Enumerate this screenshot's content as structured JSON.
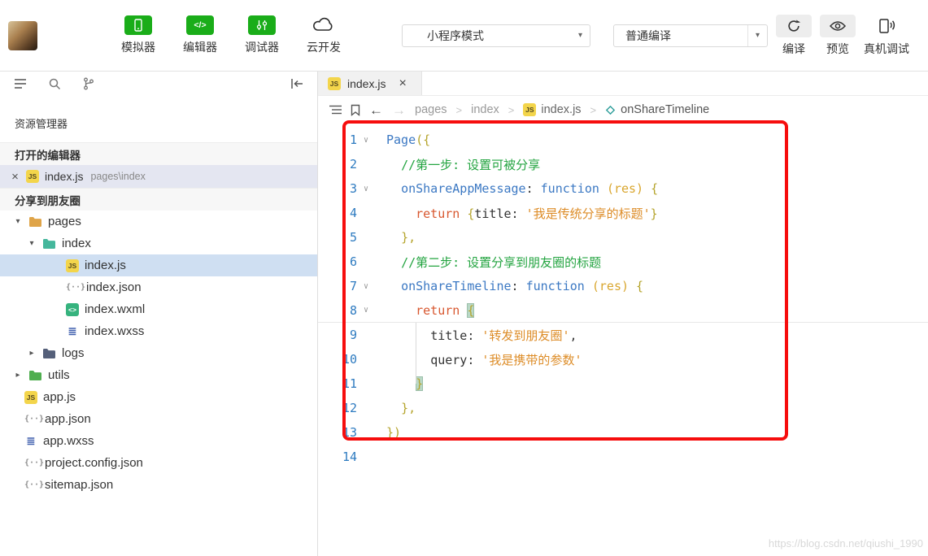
{
  "toolbar": {
    "nav_buttons": [
      {
        "label": "模拟器",
        "icon": "simulator-icon"
      },
      {
        "label": "编辑器",
        "icon": "editor-icon"
      },
      {
        "label": "调试器",
        "icon": "debugger-icon"
      },
      {
        "label": "云开发",
        "icon": "cloud-icon"
      }
    ],
    "mode_dropdown": {
      "value": "小程序模式"
    },
    "compile_dropdown": {
      "value": "普通编译"
    },
    "actions": [
      {
        "label": "编译",
        "icon": "compile-icon"
      },
      {
        "label": "预览",
        "icon": "preview-icon"
      },
      {
        "label": "真机调试",
        "icon": "phone-debug-icon"
      }
    ]
  },
  "sidebar": {
    "explorer_title": "资源管理器",
    "open_editors": {
      "header": "打开的编辑器",
      "items": [
        {
          "name": "index.js",
          "path": "pages\\index",
          "icon": "js"
        }
      ]
    },
    "project": {
      "header": "分享到朋友圈",
      "tree": [
        {
          "label": "pages",
          "icon": "folder",
          "color": "#dfa448",
          "depth": 0,
          "arrow": "down"
        },
        {
          "label": "index",
          "icon": "folder",
          "color": "#45b79c",
          "depth": 1,
          "arrow": "down"
        },
        {
          "label": "index.js",
          "icon": "js",
          "depth": 3,
          "selected": true
        },
        {
          "label": "index.json",
          "icon": "json",
          "depth": 3
        },
        {
          "label": "index.wxml",
          "icon": "wxml",
          "depth": 3
        },
        {
          "label": "index.wxss",
          "icon": "wxss",
          "depth": 3
        },
        {
          "label": "logs",
          "icon": "folder",
          "color": "#55607a",
          "depth": 1,
          "arrow": "right"
        },
        {
          "label": "utils",
          "icon": "folder",
          "color": "#4fae4f",
          "depth": 0,
          "arrow": "right"
        },
        {
          "label": "app.js",
          "icon": "js",
          "depth": 0
        },
        {
          "label": "app.json",
          "icon": "json",
          "depth": 0
        },
        {
          "label": "app.wxss",
          "icon": "wxss",
          "depth": 0
        },
        {
          "label": "project.config.json",
          "icon": "json",
          "depth": 0
        },
        {
          "label": "sitemap.json",
          "icon": "json",
          "depth": 0
        }
      ]
    }
  },
  "editor": {
    "tab": {
      "name": "index.js"
    },
    "breadcrumb": [
      {
        "label": "pages"
      },
      {
        "label": "index"
      },
      {
        "label": "index.js",
        "icon": "js"
      },
      {
        "label": "onShareTimeline",
        "icon": "symbol-method"
      }
    ],
    "code": {
      "lines": [
        {
          "num": 1,
          "fold": true,
          "indent": 0,
          "tokens": [
            [
              "Page",
              "kw"
            ],
            [
              "({",
              "brace"
            ]
          ]
        },
        {
          "num": 2,
          "indent": 1,
          "tokens": [
            [
              "//第一步: 设置可被分享",
              "cm"
            ]
          ]
        },
        {
          "num": 3,
          "fold": true,
          "indent": 1,
          "tokens": [
            [
              "onShareAppMessage",
              "kw"
            ],
            [
              ": ",
              "pl"
            ],
            [
              "function ",
              "kw"
            ],
            [
              "(res)",
              "arg"
            ],
            [
              " {",
              "brace"
            ]
          ]
        },
        {
          "num": 4,
          "indent": 2,
          "tokens": [
            [
              "return ",
              "ret"
            ],
            [
              "{",
              "brace"
            ],
            [
              "title: ",
              "pl"
            ],
            [
              "'我是传统分享的标题'",
              "str"
            ],
            [
              "}",
              "brace"
            ]
          ]
        },
        {
          "num": 5,
          "indent": 1,
          "tokens": [
            [
              "},",
              "brace"
            ]
          ]
        },
        {
          "num": 6,
          "indent": 1,
          "tokens": [
            [
              "//第二步: 设置分享到朋友圈的标题",
              "cm"
            ]
          ]
        },
        {
          "num": 7,
          "fold": true,
          "indent": 1,
          "tokens": [
            [
              "onShareTimeline",
              "kw"
            ],
            [
              ": ",
              "pl"
            ],
            [
              "function ",
              "kw"
            ],
            [
              "(res)",
              "arg"
            ],
            [
              " {",
              "brace"
            ]
          ]
        },
        {
          "num": 8,
          "fold": true,
          "indent": 2,
          "underline": true,
          "tokens": [
            [
              "return ",
              "ret"
            ],
            [
              "{",
              "brace",
              true
            ]
          ]
        },
        {
          "num": 9,
          "indent": 3,
          "tokens": [
            [
              "title: ",
              "pl"
            ],
            [
              "'转发到朋友圈'",
              "str"
            ],
            [
              ",",
              "pl"
            ]
          ]
        },
        {
          "num": 10,
          "indent": 3,
          "tokens": [
            [
              "query: ",
              "pl"
            ],
            [
              "'我是携带的参数'",
              "str"
            ]
          ]
        },
        {
          "num": 11,
          "indent": 2,
          "tokens": [
            [
              "}",
              "brace",
              true
            ]
          ]
        },
        {
          "num": 12,
          "indent": 1,
          "tokens": [
            [
              "},",
              "brace"
            ]
          ]
        },
        {
          "num": 13,
          "indent": 0,
          "tokens": [
            [
              "})",
              "brace"
            ]
          ]
        },
        {
          "num": 14,
          "indent": 0,
          "tokens": []
        }
      ]
    }
  },
  "icons": {
    "js_badge": "JS",
    "json_badge": "{··}",
    "wxml_badge": "<>",
    "wxss_badge": "≣",
    "caret_down": "▾",
    "caret_right": "▸",
    "close": "×",
    "arrow_back": "←",
    "arrow_forward": "→",
    "fold_chevron": "∨"
  },
  "watermark": "https://blog.csdn.net/qiushi_1990"
}
